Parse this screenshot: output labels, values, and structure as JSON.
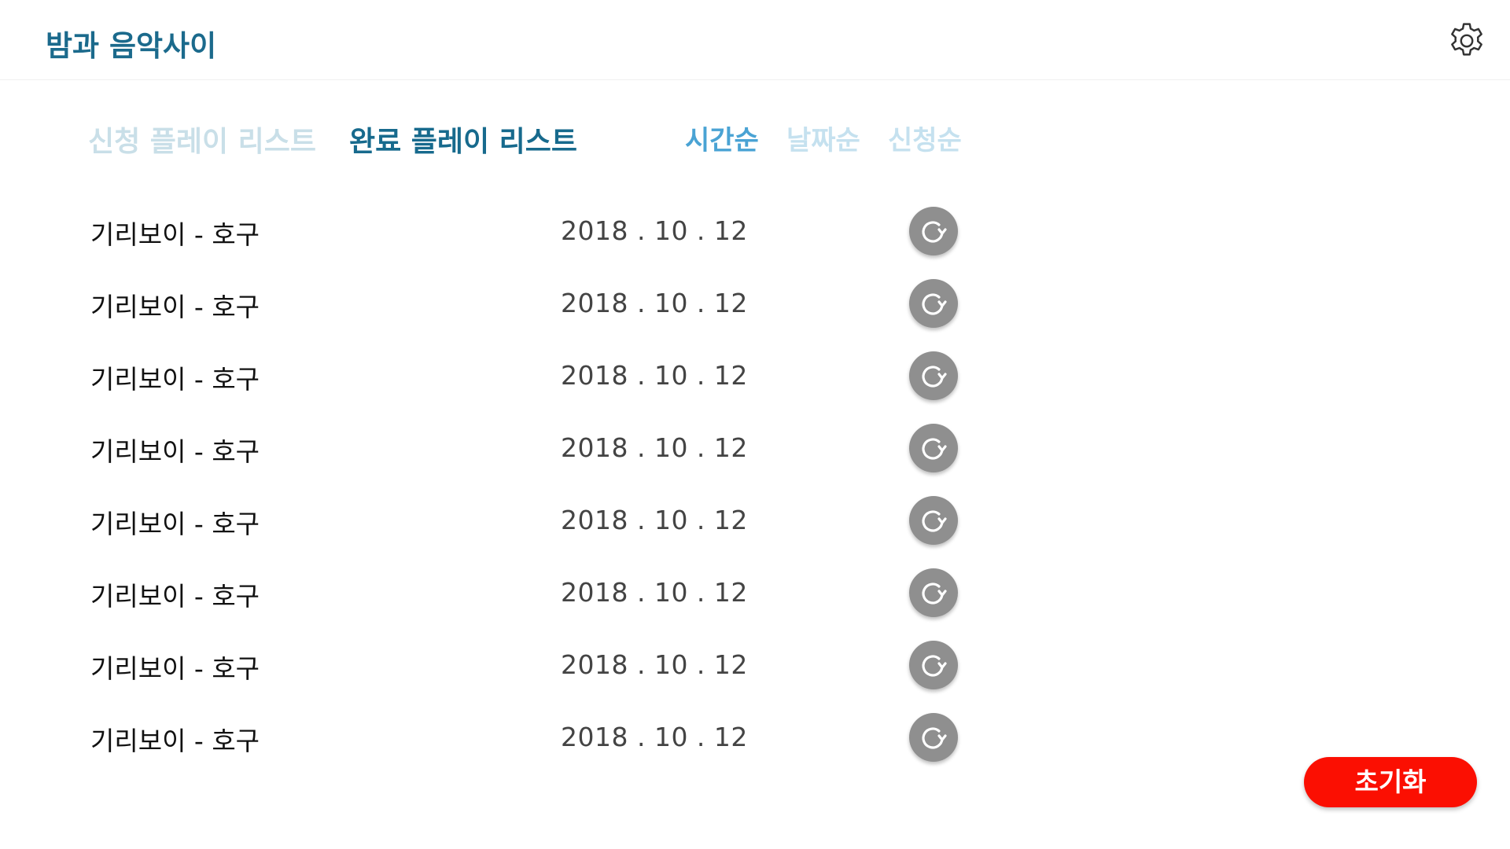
{
  "header": {
    "title": "밤과 음악사이",
    "settings_icon": "gear-icon"
  },
  "tabs": {
    "requested": "신청 플레이 리스트",
    "completed": "완료 플레이 리스트",
    "active": "completed"
  },
  "sort": {
    "time": "시간순",
    "date": "날짜순",
    "request": "신청순",
    "active": "time"
  },
  "playlist": [
    {
      "song": "기리보이 - 호구",
      "date": "2018 . 10 . 12"
    },
    {
      "song": "기리보이 - 호구",
      "date": "2018 . 10 . 12"
    },
    {
      "song": "기리보이 - 호구",
      "date": "2018 . 10 . 12"
    },
    {
      "song": "기리보이 - 호구",
      "date": "2018 . 10 . 12"
    },
    {
      "song": "기리보이 - 호구",
      "date": "2018 . 10 . 12"
    },
    {
      "song": "기리보이 - 호구",
      "date": "2018 . 10 . 12"
    },
    {
      "song": "기리보이 - 호구",
      "date": "2018 . 10 . 12"
    },
    {
      "song": "기리보이 - 호구",
      "date": "2018 . 10 . 12"
    }
  ],
  "row_action_icon": "restore-icon",
  "reset_button": "초기화",
  "colors": {
    "title": "#1b6a8c",
    "accent_sort": "#4aa3d4",
    "inactive": "#c9dfe8",
    "reset": "#fb0f02",
    "restore_bg": "#8f8f8f"
  }
}
